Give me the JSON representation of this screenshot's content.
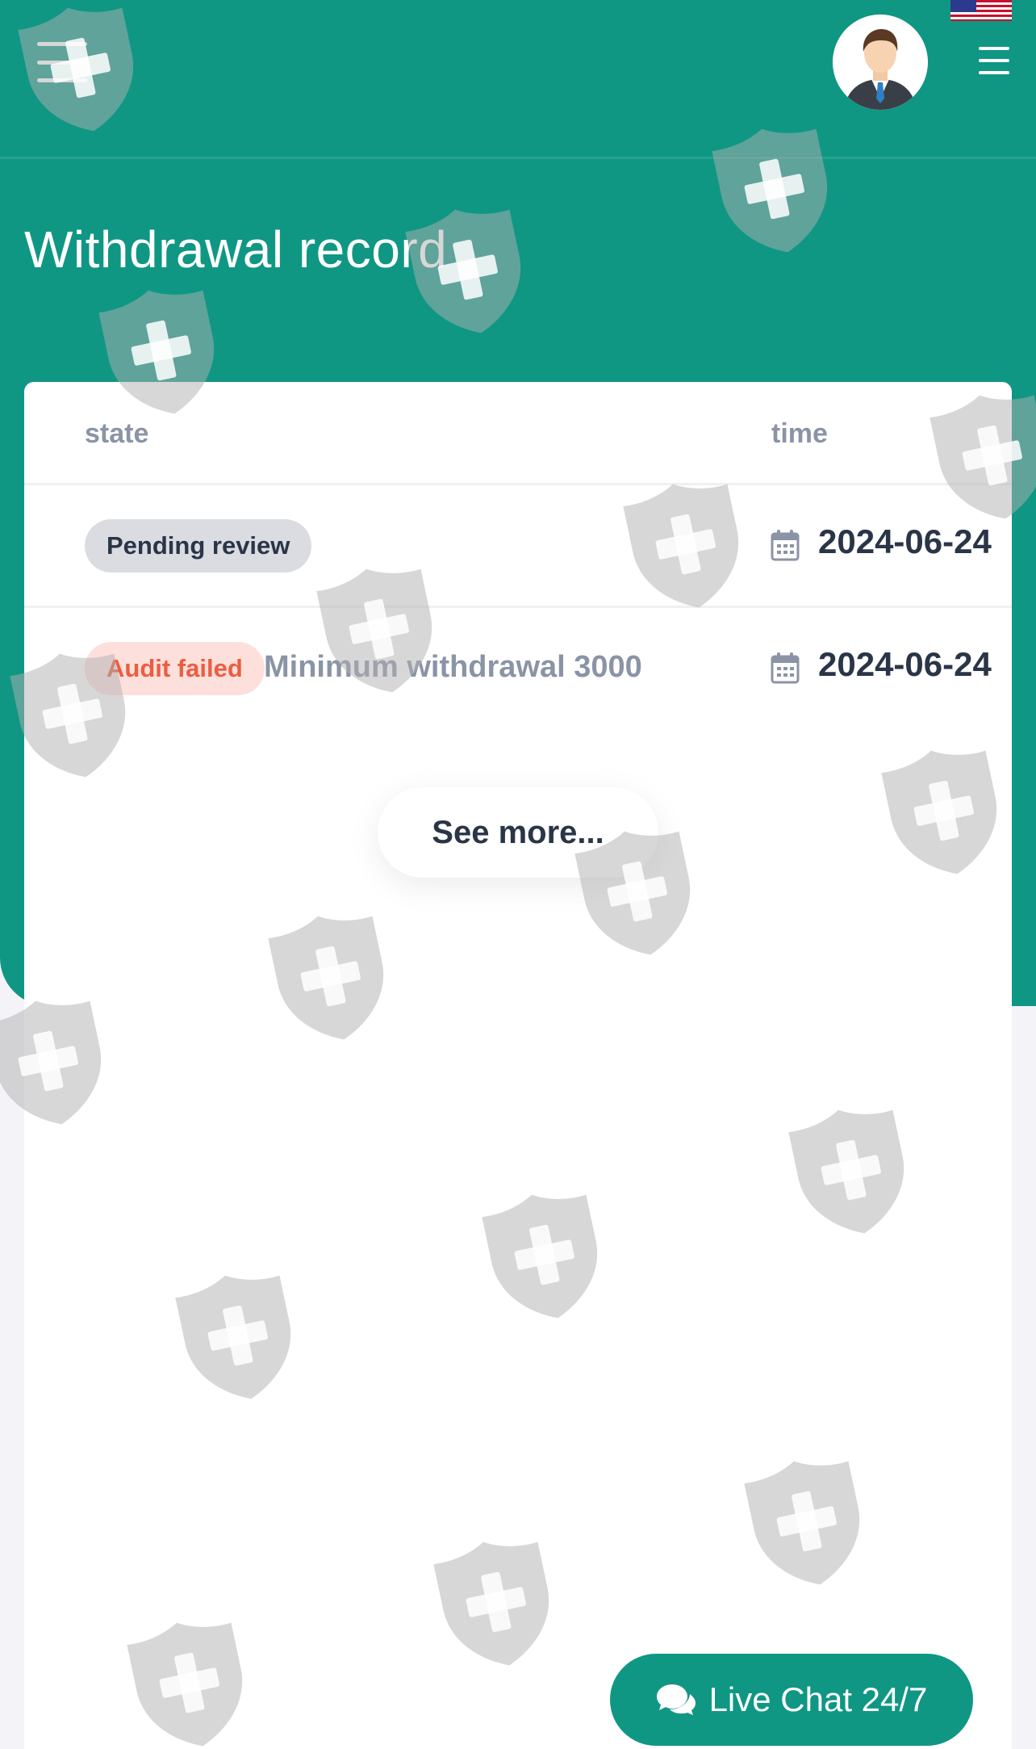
{
  "header": {
    "title": "Withdrawal record",
    "menu_icon": "hamburger-icon",
    "avatar_icon": "user-avatar",
    "language_flag": "us-flag-icon",
    "right_menu_icon": "menu-icon"
  },
  "table": {
    "columns": [
      "state",
      "time"
    ],
    "rows": [
      {
        "status": "Pending review",
        "reason": "",
        "date": "2024-06-24"
      },
      {
        "status": "Audit failed",
        "reason": "Minimum withdrawal 3000",
        "date": "2024-06-24"
      }
    ]
  },
  "see_more_label": "See more...",
  "live_chat": {
    "label": "Live Chat 24/7",
    "icon": "chat-bubbles-icon"
  },
  "colors": {
    "primary": "#0f9784",
    "text_dark": "#2a3547",
    "text_muted": "#8a94a6",
    "failed": "#ec5d3f",
    "failed_bg": "#fde0dc",
    "pending_bg": "#dadce2"
  }
}
